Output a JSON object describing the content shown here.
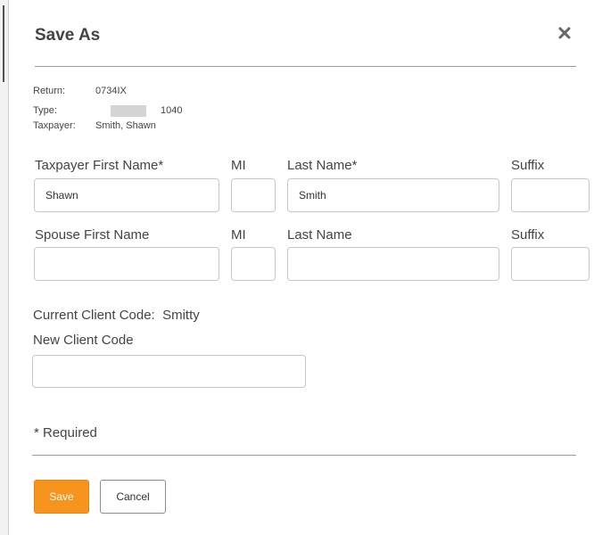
{
  "dialog": {
    "title": "Save As",
    "close_icon": "close-icon"
  },
  "info": {
    "return_label": "Return:",
    "return_value": "0734IX",
    "type_label": "Type:",
    "type_value": "1040",
    "taxpayer_label": "Taxpayer:",
    "taxpayer_value": "Smith, Shawn"
  },
  "taxpayer": {
    "first_name_label": "Taxpayer First Name*",
    "first_name_value": "Shawn",
    "mi_label": "MI",
    "mi_value": "",
    "last_name_label": "Last Name*",
    "last_name_value": "Smith",
    "suffix_label": "Suffix",
    "suffix_value": ""
  },
  "spouse": {
    "first_name_label": "Spouse First Name",
    "first_name_value": "",
    "mi_label": "MI",
    "mi_value": "",
    "last_name_label": "Last Name",
    "last_name_value": "",
    "suffix_label": "Suffix",
    "suffix_value": ""
  },
  "client_code": {
    "current_label": "Current Client Code:",
    "current_value": "Smitty",
    "new_label": "New Client Code",
    "new_value": ""
  },
  "footer": {
    "required_note": "* Required",
    "save_label": "Save",
    "cancel_label": "Cancel"
  },
  "colors": {
    "accent": "#f7941d",
    "divider": "#9a9a9a",
    "text": "#444444"
  }
}
